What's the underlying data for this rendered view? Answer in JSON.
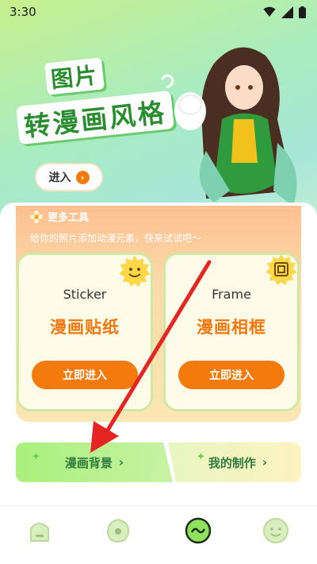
{
  "status_bar": {
    "time": "3:30"
  },
  "hero": {
    "title_line1": "图片",
    "title_line2": "转漫画风格",
    "enter_label": "进入"
  },
  "tools": {
    "title": "更多工具",
    "subtitle": "给你的照片添加动漫元素，快来试试吧～",
    "cards": [
      {
        "en": "Sticker",
        "cn": "漫画贴纸",
        "button": "立即进入",
        "icon": "smiley-sun-icon"
      },
      {
        "en": "Frame",
        "cn": "漫画相框",
        "button": "立即进入",
        "icon": "frame-square-icon"
      }
    ]
  },
  "bottom_actions": {
    "background_label": "漫画背景",
    "mine_label": "我的制作"
  },
  "nav": {
    "items": [
      "home-tab-icon",
      "discover-tab-icon",
      "create-tab-icon",
      "profile-tab-icon"
    ],
    "active_index": 2
  },
  "colors": {
    "accent_orange": "#f57a0c",
    "accent_green": "#2a8d30",
    "annotation_red": "#e52521"
  }
}
